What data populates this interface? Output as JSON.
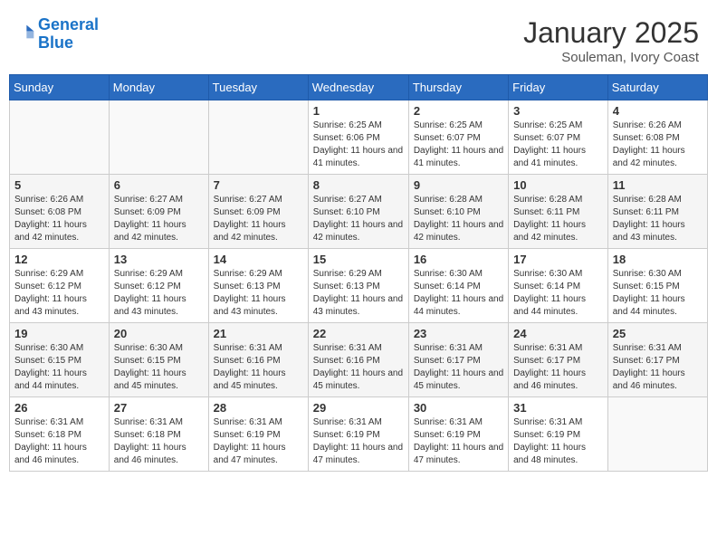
{
  "header": {
    "logo_line1": "General",
    "logo_line2": "Blue",
    "month_year": "January 2025",
    "location": "Souleman, Ivory Coast"
  },
  "days_of_week": [
    "Sunday",
    "Monday",
    "Tuesday",
    "Wednesday",
    "Thursday",
    "Friday",
    "Saturday"
  ],
  "weeks": [
    [
      {
        "day": "",
        "info": ""
      },
      {
        "day": "",
        "info": ""
      },
      {
        "day": "",
        "info": ""
      },
      {
        "day": "1",
        "info": "Sunrise: 6:25 AM\nSunset: 6:06 PM\nDaylight: 11 hours and 41 minutes."
      },
      {
        "day": "2",
        "info": "Sunrise: 6:25 AM\nSunset: 6:07 PM\nDaylight: 11 hours and 41 minutes."
      },
      {
        "day": "3",
        "info": "Sunrise: 6:25 AM\nSunset: 6:07 PM\nDaylight: 11 hours and 41 minutes."
      },
      {
        "day": "4",
        "info": "Sunrise: 6:26 AM\nSunset: 6:08 PM\nDaylight: 11 hours and 42 minutes."
      }
    ],
    [
      {
        "day": "5",
        "info": "Sunrise: 6:26 AM\nSunset: 6:08 PM\nDaylight: 11 hours and 42 minutes."
      },
      {
        "day": "6",
        "info": "Sunrise: 6:27 AM\nSunset: 6:09 PM\nDaylight: 11 hours and 42 minutes."
      },
      {
        "day": "7",
        "info": "Sunrise: 6:27 AM\nSunset: 6:09 PM\nDaylight: 11 hours and 42 minutes."
      },
      {
        "day": "8",
        "info": "Sunrise: 6:27 AM\nSunset: 6:10 PM\nDaylight: 11 hours and 42 minutes."
      },
      {
        "day": "9",
        "info": "Sunrise: 6:28 AM\nSunset: 6:10 PM\nDaylight: 11 hours and 42 minutes."
      },
      {
        "day": "10",
        "info": "Sunrise: 6:28 AM\nSunset: 6:11 PM\nDaylight: 11 hours and 42 minutes."
      },
      {
        "day": "11",
        "info": "Sunrise: 6:28 AM\nSunset: 6:11 PM\nDaylight: 11 hours and 43 minutes."
      }
    ],
    [
      {
        "day": "12",
        "info": "Sunrise: 6:29 AM\nSunset: 6:12 PM\nDaylight: 11 hours and 43 minutes."
      },
      {
        "day": "13",
        "info": "Sunrise: 6:29 AM\nSunset: 6:12 PM\nDaylight: 11 hours and 43 minutes."
      },
      {
        "day": "14",
        "info": "Sunrise: 6:29 AM\nSunset: 6:13 PM\nDaylight: 11 hours and 43 minutes."
      },
      {
        "day": "15",
        "info": "Sunrise: 6:29 AM\nSunset: 6:13 PM\nDaylight: 11 hours and 43 minutes."
      },
      {
        "day": "16",
        "info": "Sunrise: 6:30 AM\nSunset: 6:14 PM\nDaylight: 11 hours and 44 minutes."
      },
      {
        "day": "17",
        "info": "Sunrise: 6:30 AM\nSunset: 6:14 PM\nDaylight: 11 hours and 44 minutes."
      },
      {
        "day": "18",
        "info": "Sunrise: 6:30 AM\nSunset: 6:15 PM\nDaylight: 11 hours and 44 minutes."
      }
    ],
    [
      {
        "day": "19",
        "info": "Sunrise: 6:30 AM\nSunset: 6:15 PM\nDaylight: 11 hours and 44 minutes."
      },
      {
        "day": "20",
        "info": "Sunrise: 6:30 AM\nSunset: 6:15 PM\nDaylight: 11 hours and 45 minutes."
      },
      {
        "day": "21",
        "info": "Sunrise: 6:31 AM\nSunset: 6:16 PM\nDaylight: 11 hours and 45 minutes."
      },
      {
        "day": "22",
        "info": "Sunrise: 6:31 AM\nSunset: 6:16 PM\nDaylight: 11 hours and 45 minutes."
      },
      {
        "day": "23",
        "info": "Sunrise: 6:31 AM\nSunset: 6:17 PM\nDaylight: 11 hours and 45 minutes."
      },
      {
        "day": "24",
        "info": "Sunrise: 6:31 AM\nSunset: 6:17 PM\nDaylight: 11 hours and 46 minutes."
      },
      {
        "day": "25",
        "info": "Sunrise: 6:31 AM\nSunset: 6:17 PM\nDaylight: 11 hours and 46 minutes."
      }
    ],
    [
      {
        "day": "26",
        "info": "Sunrise: 6:31 AM\nSunset: 6:18 PM\nDaylight: 11 hours and 46 minutes."
      },
      {
        "day": "27",
        "info": "Sunrise: 6:31 AM\nSunset: 6:18 PM\nDaylight: 11 hours and 46 minutes."
      },
      {
        "day": "28",
        "info": "Sunrise: 6:31 AM\nSunset: 6:19 PM\nDaylight: 11 hours and 47 minutes."
      },
      {
        "day": "29",
        "info": "Sunrise: 6:31 AM\nSunset: 6:19 PM\nDaylight: 11 hours and 47 minutes."
      },
      {
        "day": "30",
        "info": "Sunrise: 6:31 AM\nSunset: 6:19 PM\nDaylight: 11 hours and 47 minutes."
      },
      {
        "day": "31",
        "info": "Sunrise: 6:31 AM\nSunset: 6:19 PM\nDaylight: 11 hours and 48 minutes."
      },
      {
        "day": "",
        "info": ""
      }
    ]
  ]
}
